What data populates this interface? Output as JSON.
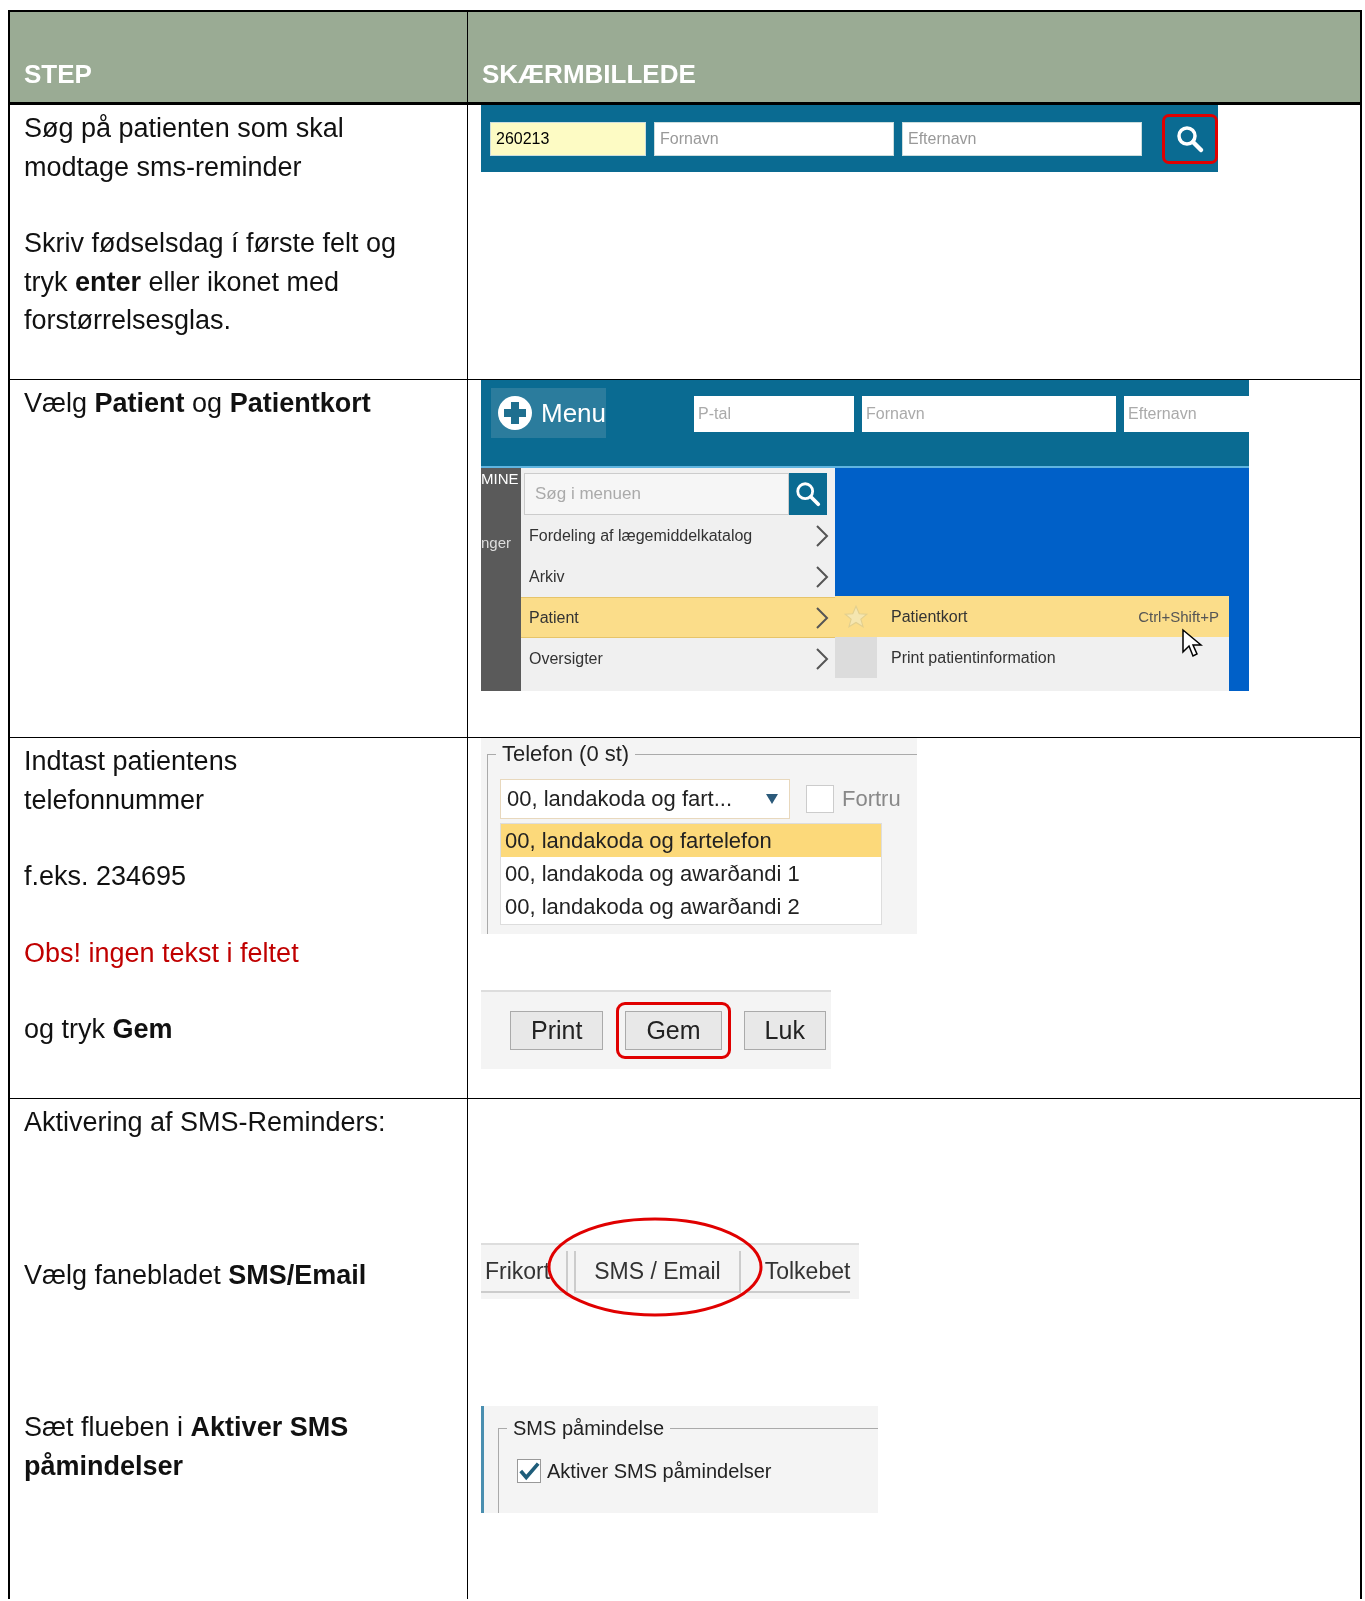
{
  "table": {
    "columns": [
      "STEP",
      "SKÆRMBILLEDE"
    ],
    "rows": [
      {
        "step": [
          {
            "kind": "normal",
            "text": "Søg på patienten som skal modtage sms-reminder"
          },
          {
            "kind": "normal",
            "text": "Skriv fødselsdag í første felt og tryk **enter** eller ikonet med forstørrelsesglas."
          }
        ],
        "screens": [
          {
            "kind": "searchbar",
            "fields": [
              {
                "value": "260213"
              },
              {
                "placeholder": "Fornavn"
              },
              {
                "placeholder": "Efternavn"
              }
            ],
            "search_circled": true
          }
        ]
      },
      {
        "step": [
          {
            "kind": "normal",
            "text": "Vælg **Patient** og **Patientkort**"
          }
        ],
        "screens": [
          {
            "kind": "menu",
            "button": "Menu",
            "fields": [
              {
                "placeholder": "P-tal"
              },
              {
                "placeholder": "Fornavn"
              },
              {
                "placeholder": "Efternavn"
              }
            ],
            "side_labels": [
              "MINE",
              "nger"
            ],
            "search_placeholder": "Søg i menuen",
            "items": [
              {
                "label": "Fordeling af lægemiddelkatalog",
                "selected": false
              },
              {
                "label": "Arkiv",
                "selected": false
              },
              {
                "label": "Patient",
                "selected": true
              },
              {
                "label": "Oversigter",
                "selected": false
              }
            ],
            "submenu": [
              {
                "label": "Patientkort",
                "shortcut": "Ctrl+Shift+P",
                "selected": true
              },
              {
                "label": "Print patientinformation",
                "selected": false
              }
            ]
          }
        ]
      },
      {
        "step": [
          {
            "kind": "normal",
            "text": "Indtast patientens telefonnummer"
          },
          {
            "kind": "normal",
            "text": "f.eks. 234695"
          },
          {
            "kind": "warning",
            "text": "Obs! ingen tekst i feltet"
          },
          {
            "kind": "normal",
            "text": "og tryk **Gem**"
          }
        ],
        "screens": [
          {
            "kind": "phone",
            "legend": "Telefon (0 st)",
            "combo": "00, landakoda og fart...",
            "checkbox": {
              "label": "Fortru",
              "checked": false
            },
            "options": [
              {
                "label": "00, landakoda og fartelefon",
                "selected": true
              },
              {
                "label": "00, landakoda og awarðandi 1",
                "selected": false
              },
              {
                "label": "00, landakoda og awarðandi 2",
                "selected": false
              }
            ]
          },
          {
            "kind": "buttons",
            "buttons": [
              {
                "label": "Print",
                "circled": false
              },
              {
                "label": "Gem",
                "circled": true
              },
              {
                "label": "Luk",
                "circled": false
              }
            ]
          }
        ]
      },
      {
        "step": [
          {
            "kind": "normal",
            "text": "Aktivering af SMS-Reminders:"
          },
          {
            "kind": "normal",
            "text": "Vælg fanebladet **SMS/Email**"
          },
          {
            "kind": "normal",
            "text": "Sæt flueben i **Aktiver SMS påmindelser**"
          }
        ],
        "screens": [
          {
            "kind": "tabs",
            "tabs": [
              {
                "label": "Frikort",
                "circled": false
              },
              {
                "label": "SMS / Email",
                "circled": true
              },
              {
                "label": "Tolkebet",
                "circled": false
              }
            ]
          },
          {
            "kind": "checkgroup",
            "legend": "SMS påmindelse",
            "checkbox": {
              "label": "Aktiver SMS påmindelser",
              "checked": true
            }
          }
        ]
      }
    ]
  }
}
